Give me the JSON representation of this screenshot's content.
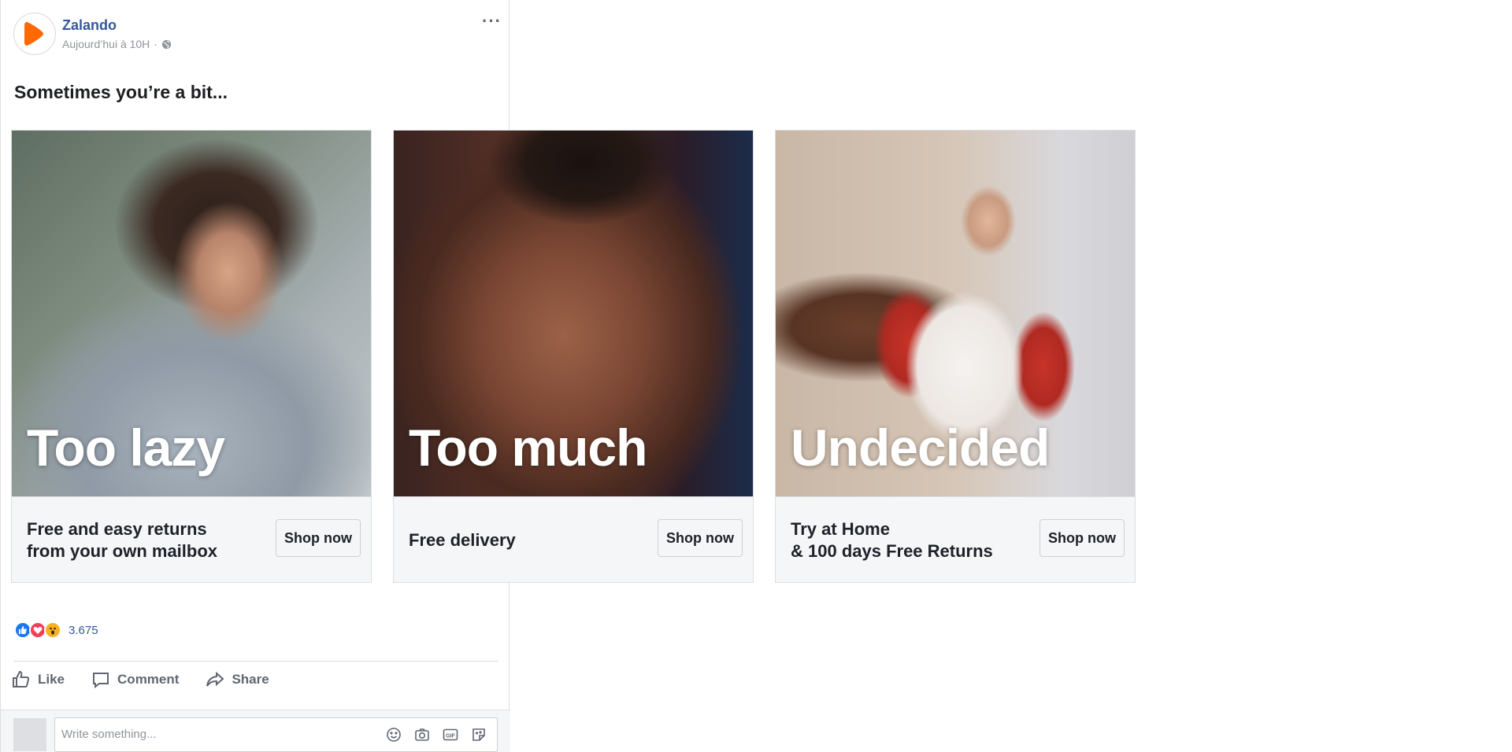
{
  "page": {
    "name": "Zalando",
    "timestamp": "Aujourd’hui à 10H",
    "separator": "·",
    "privacy_icon": "globe-icon",
    "menu_icon": "ellipsis-icon",
    "brand_color": "#ff6900",
    "link_color": "#365899"
  },
  "post": {
    "message": "Sometimes you’re a bit..."
  },
  "carousel": [
    {
      "headline": "Too lazy",
      "description": "Free and easy returns\nfrom your own mailbox",
      "cta": "Shop now",
      "image": "woman-in-grey-textured-blouse"
    },
    {
      "headline": "Too much",
      "description": "Free delivery",
      "cta": "Shop now",
      "image": "close-up-woman-curly-hair"
    },
    {
      "headline": "Undecided",
      "description": "Try at Home\n& 100 days Free Returns",
      "cta": "Shop now",
      "image": "woman-red-white-raglan-tee"
    }
  ],
  "reactions": {
    "icons": [
      "like-reaction-icon",
      "love-reaction-icon",
      "wow-reaction-icon"
    ],
    "count": "3.675"
  },
  "actions": [
    {
      "label": "Like",
      "icon": "thumbs-up-icon"
    },
    {
      "label": "Comment",
      "icon": "comment-icon"
    },
    {
      "label": "Share",
      "icon": "share-icon"
    }
  ],
  "composer": {
    "placeholder": "Write something...",
    "icons": [
      "emoji-icon",
      "camera-icon",
      "gif-icon",
      "sticker-icon"
    ]
  }
}
